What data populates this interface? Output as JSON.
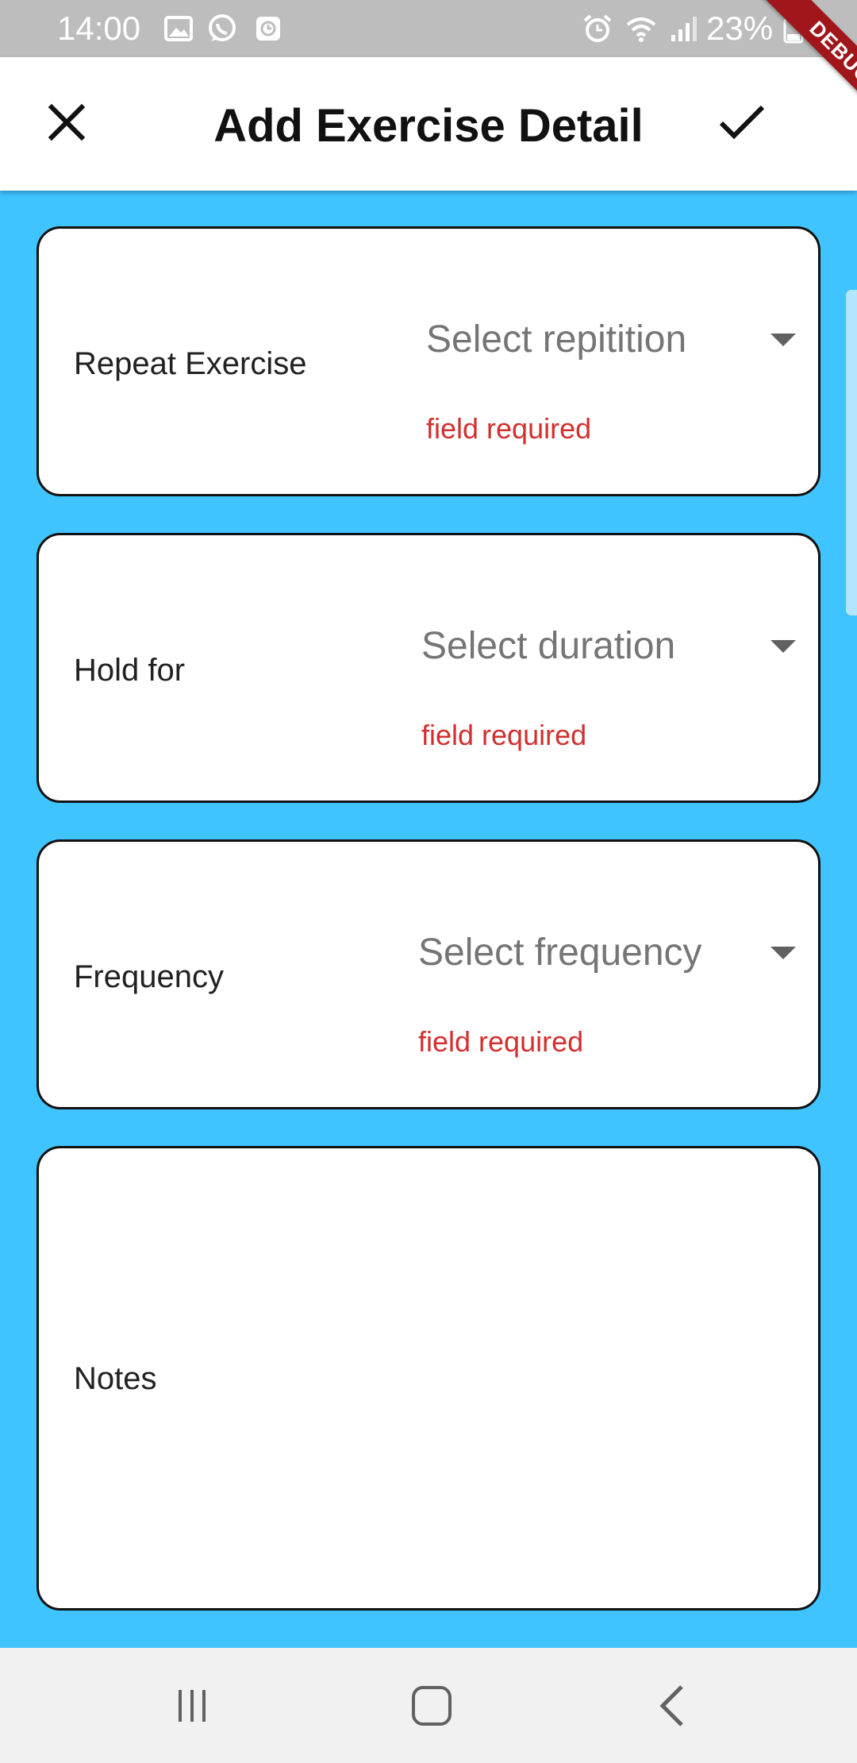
{
  "status_bar": {
    "time": "14:00",
    "battery": "23%",
    "left_icons": [
      "gallery-icon",
      "whatsapp-icon",
      "clock-app-icon"
    ],
    "right_icons": [
      "alarm-icon",
      "wifi-icon",
      "signal-icon",
      "battery-icon"
    ]
  },
  "debug_banner": {
    "label": "DEBUG",
    "color": "#a0161b"
  },
  "app_bar": {
    "title": "Add Exercise Detail",
    "close_icon": "close-icon",
    "confirm_icon": "check-icon"
  },
  "form": {
    "background": "#40c4ff",
    "fields": [
      {
        "label": "Repeat Exercise",
        "placeholder": "Select repitition",
        "error": "field required"
      },
      {
        "label": "Hold for",
        "placeholder": "Select duration",
        "error": "field required"
      },
      {
        "label": "Frequency",
        "placeholder": "Select frequency",
        "error": "field required"
      }
    ],
    "notes": {
      "label": "Notes"
    }
  },
  "colors": {
    "error": "#d32f2f",
    "placeholder": "#757575"
  },
  "nav_bar": {
    "icons": [
      "recent-apps-icon",
      "home-icon",
      "back-icon"
    ]
  }
}
